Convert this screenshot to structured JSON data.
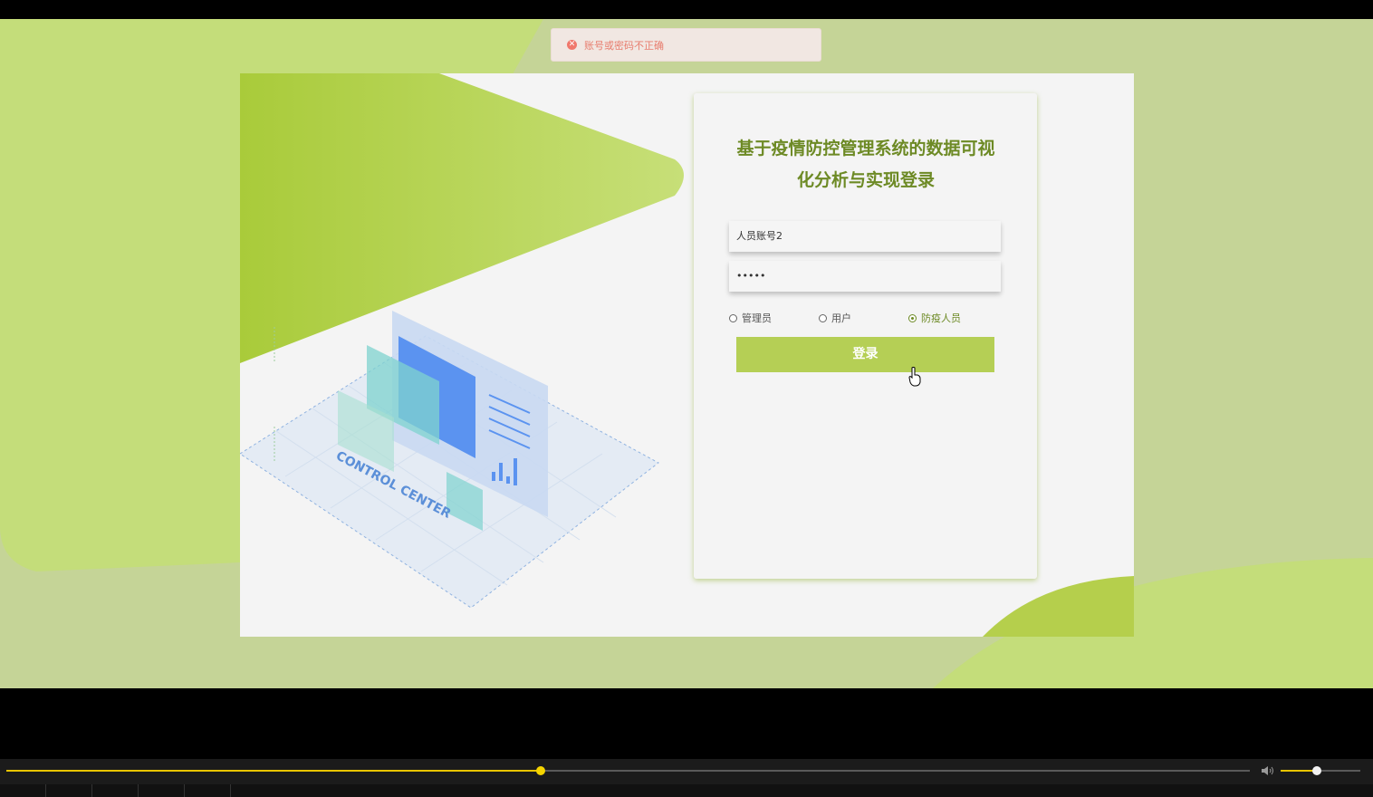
{
  "toast": {
    "message": "账号或密码不正确",
    "icon": "error-circle-icon",
    "color": "#e87d6e"
  },
  "illustration": {
    "caption": "CONTROL CENTER"
  },
  "login": {
    "title": "基于疫情防控管理系统的数据可视化分析与实现登录",
    "username_value": "人员账号2",
    "password_value": "•••••",
    "roles": [
      {
        "label": "管理员",
        "selected": false
      },
      {
        "label": "用户",
        "selected": false
      },
      {
        "label": "防疫人员",
        "selected": true
      }
    ],
    "submit_label": "登录"
  },
  "player": {
    "progress": 0.43,
    "volume": 0.45,
    "volume_icon": "volume-icon"
  },
  "colors": {
    "accent": "#b5cf55",
    "title": "#6d8a25",
    "background": "#c5d497"
  }
}
